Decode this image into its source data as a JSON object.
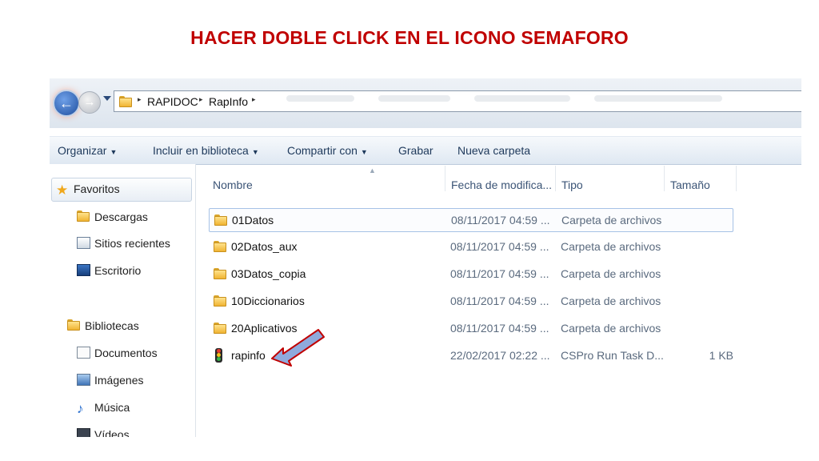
{
  "slide": {
    "title": "HACER DOBLE CLICK EN EL ICONO SEMAFORO"
  },
  "address_bar": {
    "back_glyph": "←",
    "forward_glyph": "→",
    "crumbs": [
      "RAPIDOC",
      "RapInfo"
    ],
    "separator": "▸"
  },
  "toolbar": {
    "organizar": "Organizar",
    "incluir": "Incluir en biblioteca",
    "compartir": "Compartir con",
    "grabar": "Grabar",
    "nueva_carpeta": "Nueva carpeta",
    "dropdown_glyph": "▼"
  },
  "nav": {
    "favoritos": "Favoritos",
    "descargas": "Descargas",
    "sitios_recientes": "Sitios recientes",
    "escritorio": "Escritorio",
    "bibliotecas": "Bibliotecas",
    "documentos": "Documentos",
    "imagenes": "Imágenes",
    "musica": "Música",
    "videos": "Vídeos"
  },
  "columns": {
    "nombre": "Nombre",
    "fecha": "Fecha de modifica...",
    "tipo": "Tipo",
    "tamano": "Tamaño",
    "sort_glyph": "▲"
  },
  "files": [
    {
      "name": "01Datos",
      "date": "08/11/2017 04:59 ...",
      "type": "Carpeta de archivos",
      "size": "",
      "icon": "folder-icon"
    },
    {
      "name": "02Datos_aux",
      "date": "08/11/2017 04:59 ...",
      "type": "Carpeta de archivos",
      "size": "",
      "icon": "folder-icon"
    },
    {
      "name": "03Datos_copia",
      "date": "08/11/2017 04:59 ...",
      "type": "Carpeta de archivos",
      "size": "",
      "icon": "folder-icon"
    },
    {
      "name": "10Diccionarios",
      "date": "08/11/2017 04:59 ...",
      "type": "Carpeta de archivos",
      "size": "",
      "icon": "folder-icon"
    },
    {
      "name": "20Aplicativos",
      "date": "08/11/2017 04:59 ...",
      "type": "Carpeta de archivos",
      "size": "",
      "icon": "folder-icon"
    },
    {
      "name": "rapinfo",
      "date": "22/02/2017 02:22 ...",
      "type": "CSPro Run Task D...",
      "size": "1 KB",
      "icon": "traffic-light-icon"
    }
  ],
  "colors": {
    "title_red": "#c00000",
    "arrow_blue": "#8faadc",
    "arrow_outline": "#c00000",
    "selection_border": "#a6c2e6"
  }
}
